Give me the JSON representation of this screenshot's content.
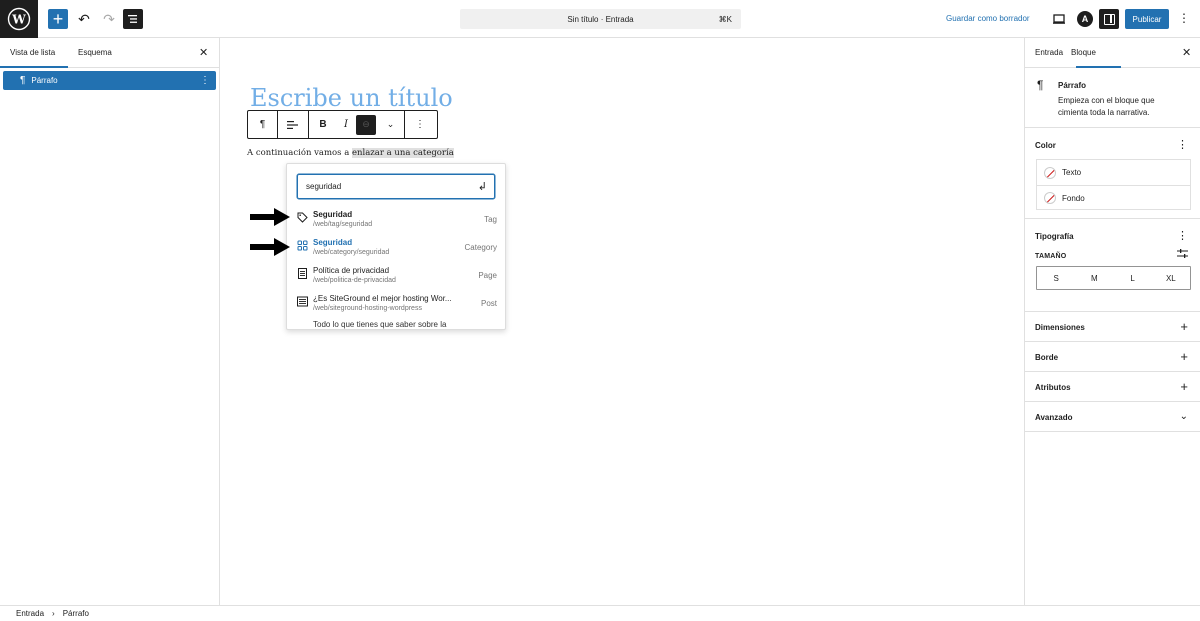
{
  "topbar": {
    "document_title": "Sin título · Entrada",
    "shortcut": "⌘K",
    "save_draft": "Guardar como borrador",
    "publish": "Publicar",
    "astra_letter": "A"
  },
  "left_panel": {
    "tabs": [
      "Vista de lista",
      "Esquema"
    ],
    "items": [
      {
        "label": "Párrafo"
      }
    ]
  },
  "editor": {
    "title_placeholder": "Escribe un título",
    "paragraph_before": "A continuación vamos a ",
    "paragraph_selected": "enlazar a una categoría",
    "link_search_value": "seguridad",
    "results": [
      {
        "title": "Seguridad",
        "url": "/web/tag/seguridad",
        "type": "Tag",
        "icon": "tag-icon"
      },
      {
        "title": "Seguridad",
        "url": "/web/category/seguridad",
        "type": "Category",
        "icon": "category-icon"
      },
      {
        "title": "Política de privacidad",
        "url": "/web/politica-de-privacidad",
        "type": "Page",
        "icon": "page-icon"
      },
      {
        "title": "¿Es SiteGround el mejor hosting Wor...",
        "url": "/web/siteground-hosting-wordpress",
        "type": "Post",
        "icon": "post-icon"
      },
      {
        "title": "Todo lo que tienes que saber sobre la",
        "url": "",
        "type": "",
        "icon": ""
      }
    ]
  },
  "right_panel": {
    "tabs": [
      "Entrada",
      "Bloque"
    ],
    "block_name": "Párrafo",
    "block_desc": "Empieza con el bloque que cimienta toda la narrativa.",
    "color_title": "Color",
    "color_items": [
      "Texto",
      "Fondo"
    ],
    "typography_title": "Tipografía",
    "size_label": "TAMAÑO",
    "sizes": [
      "S",
      "M",
      "L",
      "XL"
    ],
    "sections": [
      "Dimensiones",
      "Borde",
      "Atributos",
      "Avanzado"
    ]
  },
  "footer": {
    "crumbs": [
      "Entrada",
      "Párrafo"
    ]
  },
  "colors": {
    "accent": "#2271b1",
    "title_placeholder": "#72aee6",
    "dark": "#1e1e1e"
  }
}
